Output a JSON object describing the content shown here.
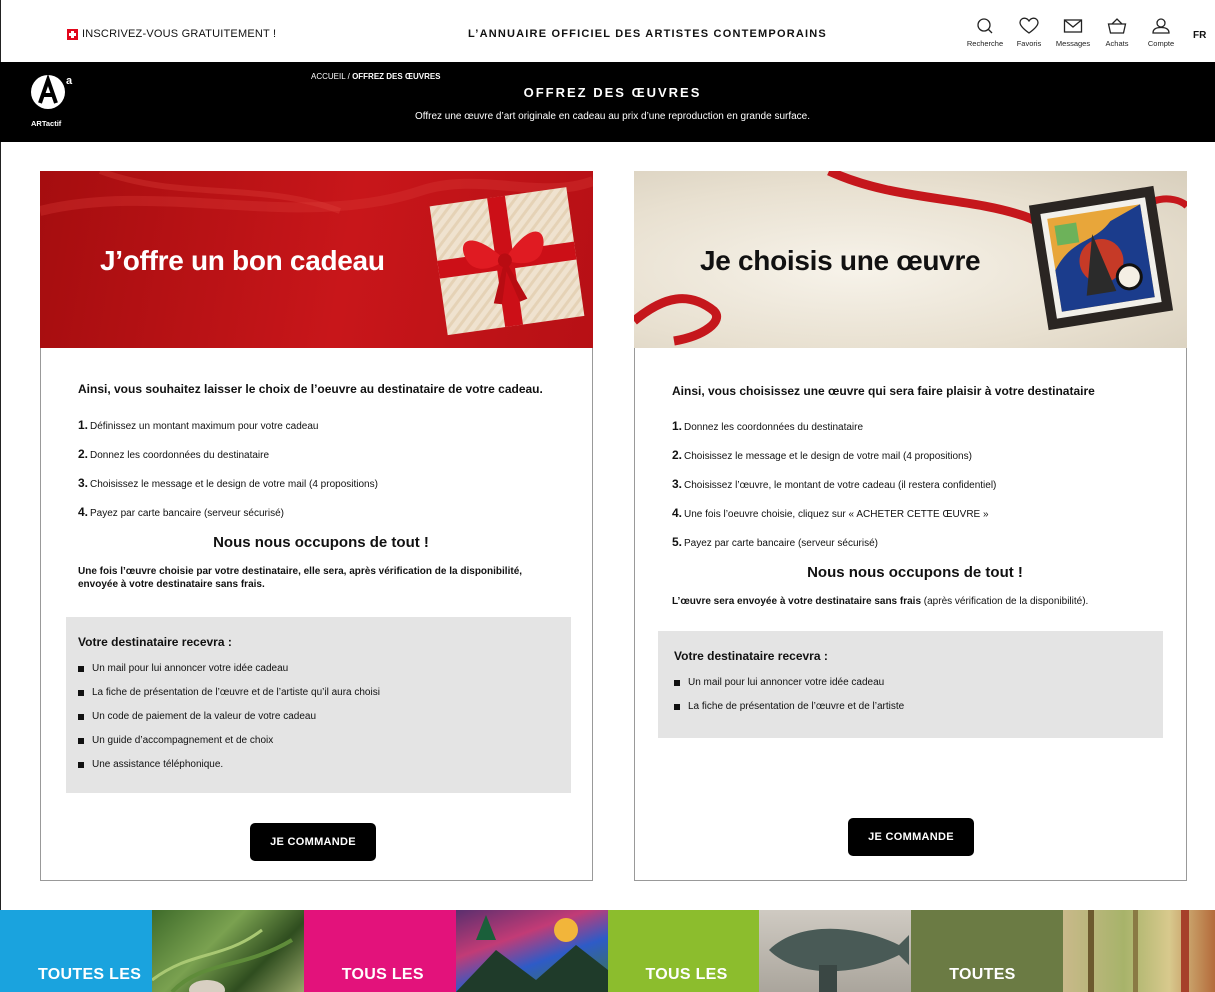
{
  "topbar": {
    "signup": "INSCRIVEZ-VOUS GRATUITEMENT !",
    "tagline": "L’ANNUAIRE OFFICIEL DES ARTISTES CONTEMPORAINS",
    "nav": [
      {
        "label": "Recherche",
        "icon": "search-icon"
      },
      {
        "label": "Favoris",
        "icon": "heart-icon"
      },
      {
        "label": "Messages",
        "icon": "envelope-icon"
      },
      {
        "label": "Achats",
        "icon": "basket-icon"
      },
      {
        "label": "Compte",
        "icon": "user-icon"
      }
    ],
    "lang": "FR"
  },
  "header": {
    "logo_text": "ARTactif",
    "breadcrumb_home": "ACCUEIL",
    "breadcrumb_sep": " / ",
    "breadcrumb_current": "OFFREZ DES ŒUVRES",
    "title": "OFFREZ DES ŒUVRES",
    "subtitle": "Offrez une œuvre d’art originale en cadeau au prix d’une reproduction en grande surface."
  },
  "left_card": {
    "banner_title": "J’offre un bon cadeau",
    "lead": "Ainsi, vous souhaitez laisser le choix de l’oeuvre au destinataire de votre cadeau.",
    "steps": [
      {
        "num": "1.",
        "text": "Définissez un montant maximum pour votre cadeau"
      },
      {
        "num": "2.",
        "text": "Donnez les coordonnées du destinataire"
      },
      {
        "num": "3.",
        "text": "Choisissez le message et le design de votre mail (4 propositions)"
      },
      {
        "num": "4.",
        "text": "Payez par carte bancaire (serveur sécurisé)"
      }
    ],
    "sub_title": "Nous nous occupons de tout !",
    "note": "Une fois l’œuvre choisie par votre destinataire, elle sera, après vérification de la disponibilité, envoyée à votre destinataire sans frais.",
    "recv_title": "Votre destinataire recevra :",
    "recv_items": [
      "Un mail pour lui annoncer votre idée cadeau",
      "La fiche de présentation de l’œuvre et de l’artiste qu’il aura choisi",
      "Un code de paiement de la valeur de votre cadeau",
      "Un guide d’accompagnement et de choix",
      "Une assistance téléphonique."
    ],
    "button": "JE COMMANDE"
  },
  "right_card": {
    "banner_title": "Je choisis une œuvre",
    "lead": "Ainsi, vous choisissez une œuvre qui sera faire plaisir à votre destinataire",
    "steps": [
      {
        "num": "1.",
        "text": "Donnez les coordonnées du destinataire"
      },
      {
        "num": "2.",
        "text": "Choisissez le message et le design de votre mail (4 propositions)"
      },
      {
        "num": "3.",
        "text": "Choisissez l’œuvre, le montant de votre cadeau (il restera confidentiel)"
      },
      {
        "num": "4.",
        "text": "Une fois l’oeuvre choisie, cliquez sur « ACHETER CETTE ŒUVRE »"
      },
      {
        "num": "5.",
        "text": "Payez par carte bancaire (serveur sécurisé)"
      }
    ],
    "sub_title": "Nous nous occupons de tout !",
    "note_bold": "L’œuvre sera envoyée à votre destinataire sans frais",
    "note_rest": " (après vérification de la disponibilité).",
    "recv_title": "Votre destinataire recevra :",
    "recv_items": [
      "Un mail pour lui annoncer votre idée cadeau",
      "La fiche de présentation de l’œuvre et de l’artiste"
    ],
    "button": "JE COMMANDE"
  },
  "categories": [
    {
      "label": "TOUTES LES",
      "color": "#1aa3de"
    },
    {
      "label": "TOUS LES",
      "color": "#e3127b"
    },
    {
      "label": "TOUS LES",
      "color": "#8cbd2d"
    },
    {
      "label": "TOUTES",
      "color": "#6b7b44"
    }
  ]
}
